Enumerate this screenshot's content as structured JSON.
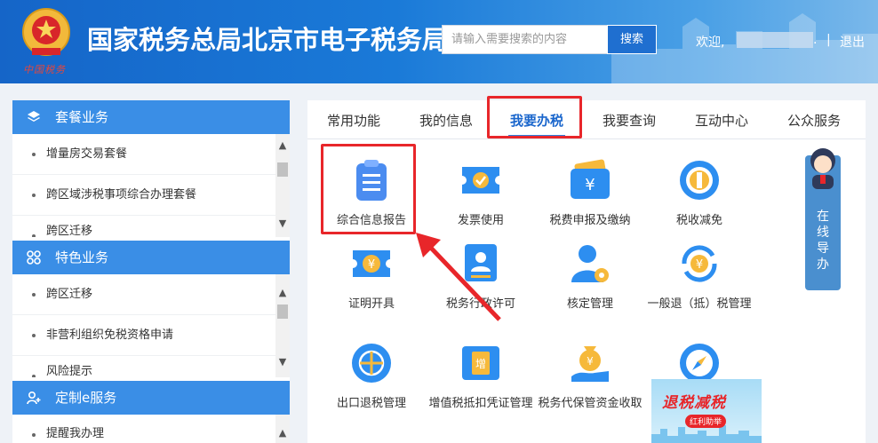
{
  "header": {
    "site_title": "国家税务总局北京市电子税务局",
    "emblem_subtitle": "中国税务",
    "search_placeholder": "请输入需要搜索的内容",
    "search_button": "搜索",
    "welcome": "欢迎,",
    "welcome_tail": ".",
    "separator": "|",
    "logout": "退出"
  },
  "sidebar": {
    "panels": [
      {
        "title": "套餐业务",
        "icon": "layers-icon",
        "items": [
          "增量房交易套餐",
          "跨区域涉税事项综合办理套餐",
          "跨区迁移"
        ]
      },
      {
        "title": "特色业务",
        "icon": "grid-icon",
        "items": [
          "跨区迁移",
          "非营利组织免税资格申请",
          "风险提示"
        ]
      },
      {
        "title": "定制e服务",
        "icon": "user-plus-icon",
        "items": [
          "提醒我办理"
        ]
      }
    ]
  },
  "tabs": [
    {
      "label": "常用功能"
    },
    {
      "label": "我的信息"
    },
    {
      "label": "我要办税"
    },
    {
      "label": "我要查询"
    },
    {
      "label": "互动中心"
    },
    {
      "label": "公众服务"
    }
  ],
  "active_tab": "我要办税",
  "tiles": [
    {
      "label": "综合信息报告",
      "icon": "clipboard-icon"
    },
    {
      "label": "发票使用",
      "icon": "invoice-check-icon"
    },
    {
      "label": "税费申报及缴纳",
      "icon": "wallet-yuan-icon"
    },
    {
      "label": "税收减免",
      "icon": "tax-reduce-icon"
    },
    {
      "label": "证明开具",
      "icon": "certificate-icon"
    },
    {
      "label": "税务行政许可",
      "icon": "license-person-icon"
    },
    {
      "label": "核定管理",
      "icon": "user-gear-icon"
    },
    {
      "label": "一般退（抵）税管理",
      "icon": "refund-cycle-icon"
    },
    {
      "label": "出口退税管理",
      "icon": "globe-icon"
    },
    {
      "label": "增值税抵扣凭证管理",
      "icon": "vat-ticket-icon"
    },
    {
      "label": "税务代保管资金收取",
      "icon": "money-bag-hand-icon"
    },
    {
      "label": "",
      "icon": "compass-icon"
    }
  ],
  "guide": {
    "text": "在线导办"
  },
  "promo": {
    "title": "退税减税",
    "subtitle": "红利助举"
  },
  "colors": {
    "brand_blue": "#1a66cc",
    "header_blue": "#1565c8",
    "highlight_red": "#e8262a"
  }
}
